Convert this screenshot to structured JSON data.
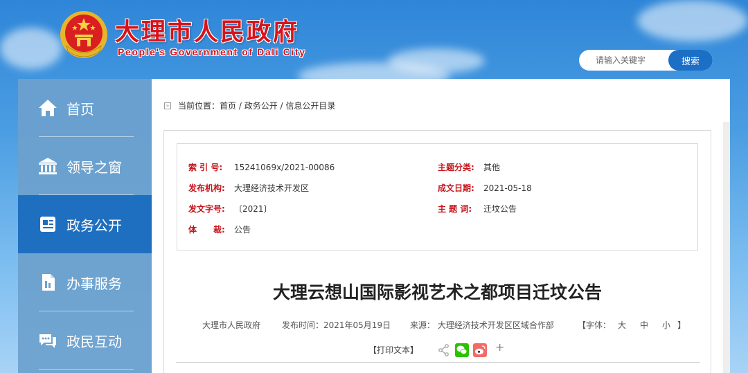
{
  "header": {
    "title": "大理市人民政府",
    "subtitle": "People's Government of Dali City",
    "search_placeholder": "请输入关键字",
    "search_button": "搜索"
  },
  "sidebar": {
    "items": [
      {
        "label": "首页",
        "icon": "home-icon",
        "active": false
      },
      {
        "label": "领导之窗",
        "icon": "bank-icon",
        "active": false
      },
      {
        "label": "政务公开",
        "icon": "profile-card-icon",
        "active": true
      },
      {
        "label": "办事服务",
        "icon": "document-icon",
        "active": false
      },
      {
        "label": "政民互动",
        "icon": "chat-icon",
        "active": false
      }
    ]
  },
  "breadcrumb": {
    "prefix": "当前位置：",
    "home": "首页",
    "sep1": " / ",
    "level1": "政务公开",
    "sep2": " / ",
    "level2": "信息公开目录"
  },
  "meta": {
    "index_label": "索 引 号:",
    "index_value": "15241069x/2021-00086",
    "category_label": "主题分类:",
    "category_value": "其他",
    "publisher_label": "发布机构:",
    "publisher_value": "大理经济技术开发区",
    "date_label": "成文日期:",
    "date_value": "2021-05-18",
    "docno_label": "发文字号:",
    "docno_value": "〔2021〕",
    "subject_label": "主 题 词:",
    "subject_value": "迁坟公告",
    "genre_label": "体　　裁:",
    "genre_value": "公告"
  },
  "article": {
    "title": "大理云想山国际影视艺术之都项目迁坟公告",
    "author": "大理市人民政府",
    "publish_time": "发布时间：2021年05月19日",
    "source": "来源： 大理经济技术开发区区域合作部",
    "font_prefix": "【字体：",
    "font_large": "大",
    "font_medium": "中",
    "font_small": "小",
    "font_suffix": "】",
    "print_label": "【打印文本】",
    "plus": "+"
  },
  "colors": {
    "brand_red": "#d8121a",
    "nav_active": "#1f6fc0",
    "button_blue": "#1c6fc6",
    "wechat_green": "#2dc100",
    "weibo_red": "#f36a6a"
  }
}
